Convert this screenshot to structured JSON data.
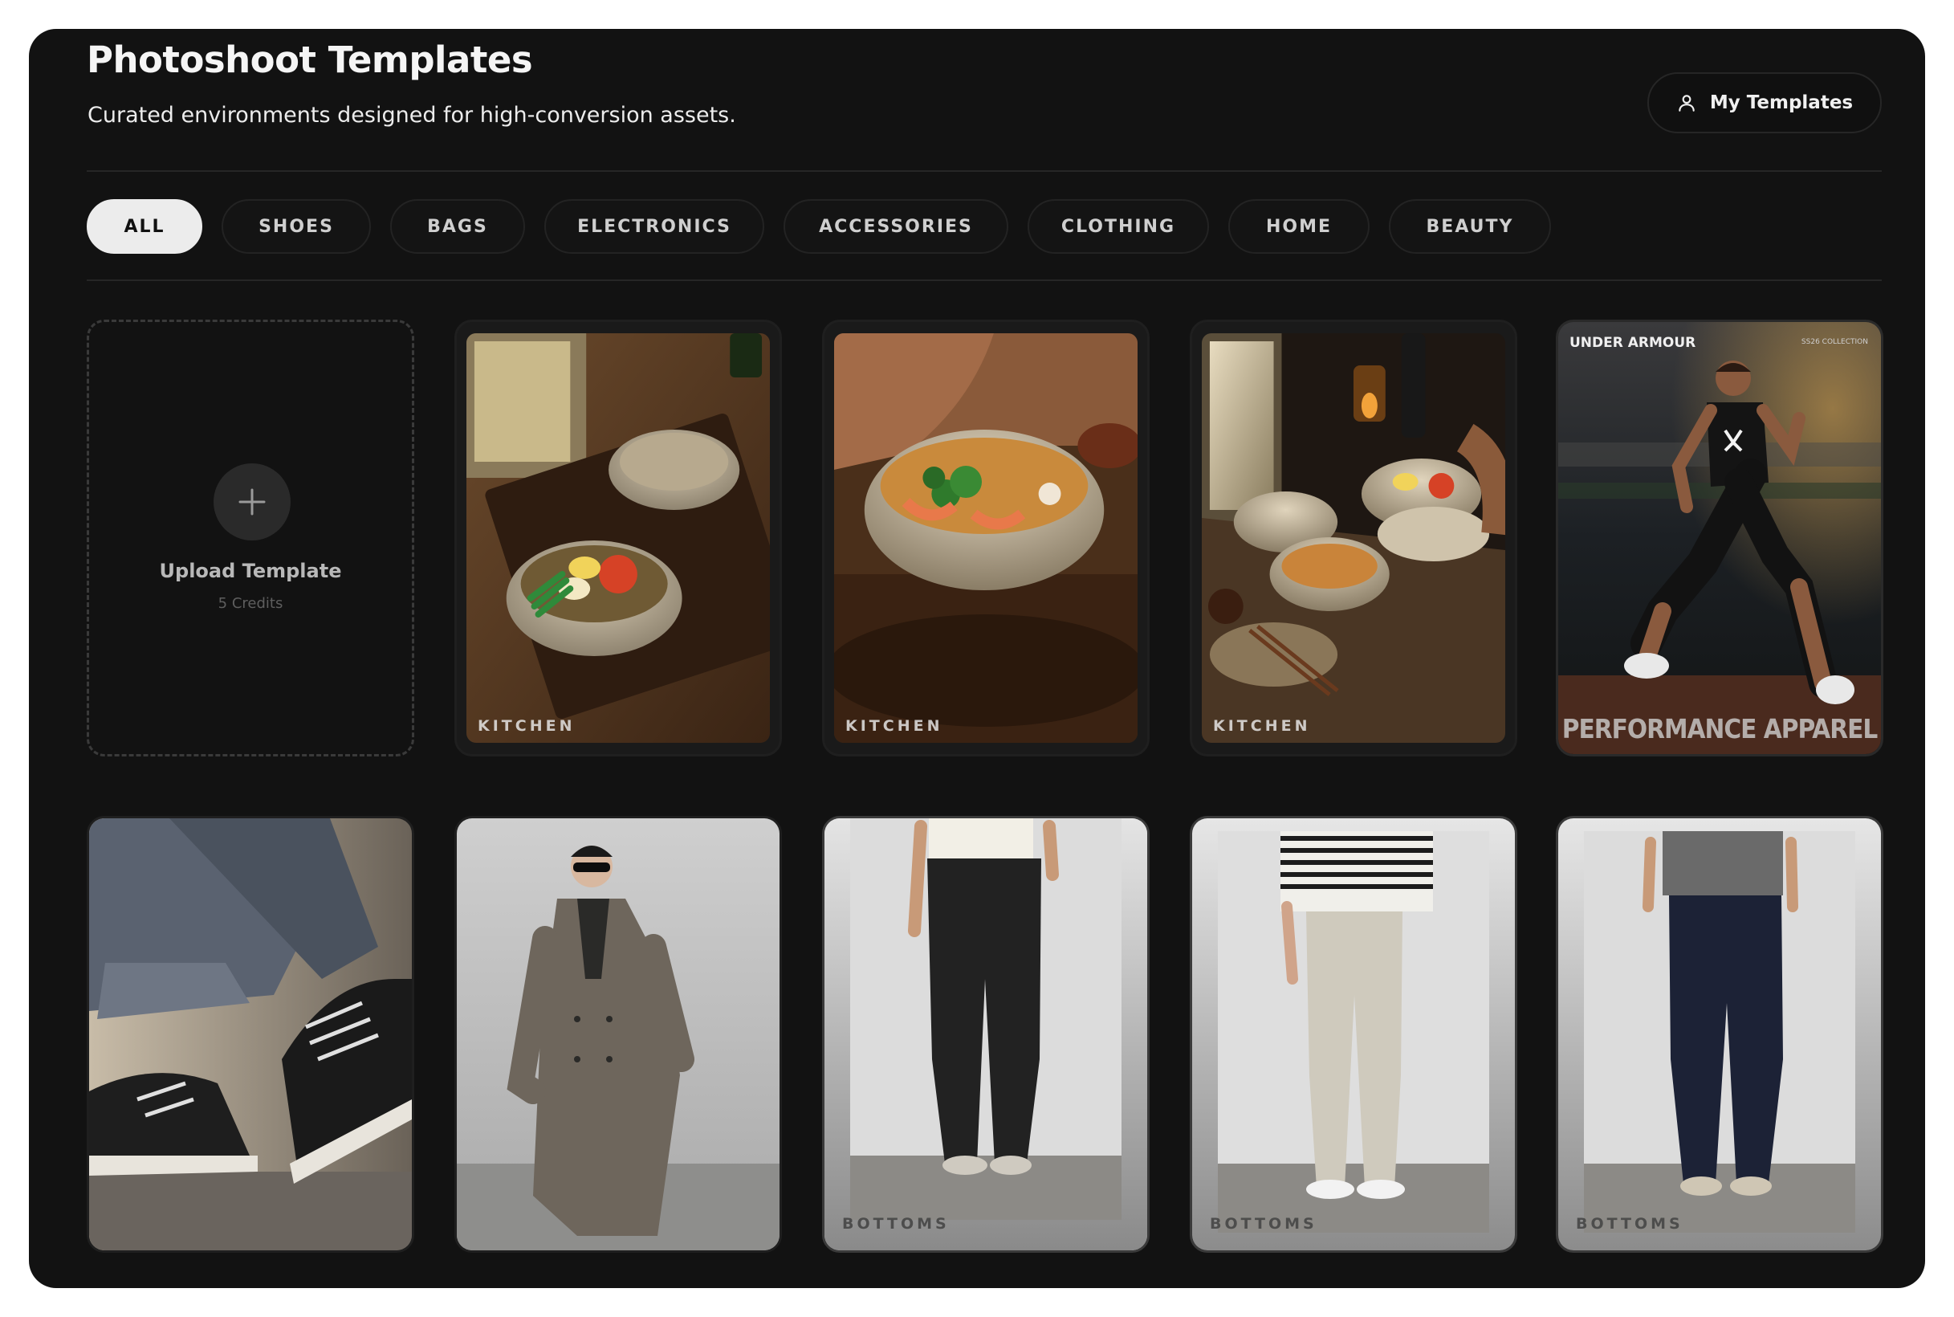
{
  "header": {
    "title": "Photoshoot Templates",
    "subtitle": "Curated environments designed for high-conversion assets.",
    "my_templates_label": "My Templates",
    "my_templates_icon": "user-icon"
  },
  "categories": [
    {
      "label": "ALL",
      "active": true
    },
    {
      "label": "SHOES",
      "active": false
    },
    {
      "label": "BAGS",
      "active": false
    },
    {
      "label": "ELECTRONICS",
      "active": false
    },
    {
      "label": "ACCESSORIES",
      "active": false
    },
    {
      "label": "CLOTHING",
      "active": false
    },
    {
      "label": "HOME",
      "active": false
    },
    {
      "label": "BEAUTY",
      "active": false
    }
  ],
  "upload": {
    "label": "Upload Template",
    "credits": "5 Credits",
    "icon": "plus-icon"
  },
  "templates": [
    {
      "tag": "KITCHEN",
      "subject": "ramen bowl with eggs and tomato on wooden tray"
    },
    {
      "tag": "KITCHEN",
      "subject": "hands holding shrimp ramen bowl"
    },
    {
      "tag": "KITCHEN",
      "subject": "windowsill table with bowls and sake bottle"
    },
    {
      "tag": "",
      "brand": "UNDER ARMOUR",
      "collection": "SS26 COLLECTION",
      "headline": "PERFORMANCE APPAREL",
      "subject": "athlete running in stadium"
    },
    {
      "tag": "",
      "subject": "jeans and black sneakers"
    },
    {
      "tag": "",
      "subject": "model in taupe trench coat with sunglasses"
    },
    {
      "tag": "BOTTOMS",
      "subject": "black drawstring trousers"
    },
    {
      "tag": "BOTTOMS",
      "subject": "cream pleated trousers with striped tee"
    },
    {
      "tag": "BOTTOMS",
      "subject": "navy wide-leg trousers"
    }
  ],
  "colors": {
    "panel": "#121212",
    "pill_active_bg": "#ececec",
    "pill_border": "#232323"
  }
}
